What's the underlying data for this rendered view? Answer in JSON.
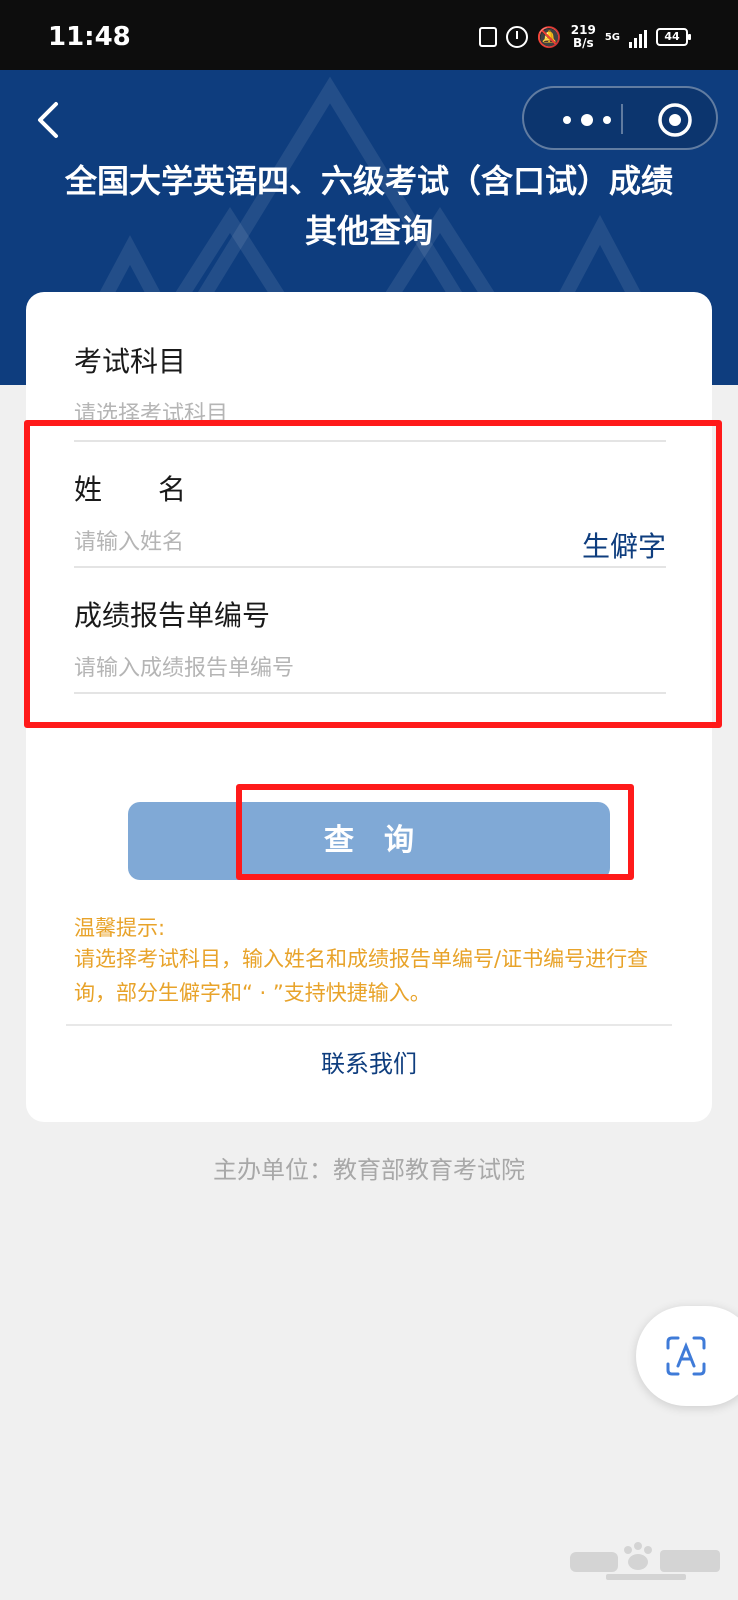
{
  "status_bar": {
    "time": "11:48",
    "net_speed_value": "219",
    "net_speed_unit": "B/s",
    "network": "5G",
    "battery": "44"
  },
  "header": {
    "title_line1": "全国大学英语四、六级考试（含口试）成绩",
    "title_line2": "其他查询",
    "background_color": "#0e3d7e"
  },
  "form": {
    "subject_label": "考试科目",
    "subject_placeholder": "请选择考试科目",
    "name_label": "姓　　名",
    "name_placeholder": "请输入姓名",
    "rare_char_link": "生僻字",
    "report_label": "成绩报告单编号",
    "report_placeholder": "请输入成绩报告单编号",
    "query_button": "查　询"
  },
  "tips": {
    "title": "温馨提示:",
    "body": "请选择考试科目，输入姓名和成绩报告单编号/证书编号进行查询，部分生僻字和“ · ”支持快捷输入。",
    "color": "#e8a32a"
  },
  "contact_link": "联系我们",
  "sponsor": "主办单位：教育部教育考试院",
  "highlight_color": "#ff1a1a",
  "icons": {
    "back": "chevron-left-icon",
    "more": "more-dots-icon",
    "close": "target-circle-icon",
    "float": "text-scan-icon"
  }
}
